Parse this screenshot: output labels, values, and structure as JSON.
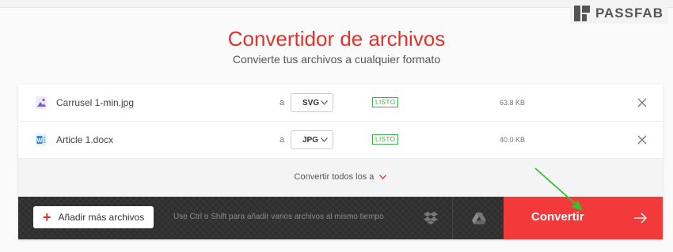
{
  "watermark": {
    "brand": "PASSFAB"
  },
  "header": {
    "title": "Convertidor de archivos",
    "subtitle": "Convierte tus archivos a cualquier formato"
  },
  "files": [
    {
      "name": "Carrusel 1-min.jpg",
      "type_icon": "image-file-icon",
      "to_label": "a",
      "format": "SVG",
      "status": "LISTO",
      "size": "63.8 KB"
    },
    {
      "name": "Article 1.docx",
      "type_icon": "word-file-icon",
      "to_label": "a",
      "format": "JPG",
      "status": "LISTO",
      "size": "40.0 KB"
    }
  ],
  "convert_all": {
    "label": "Convertir todos los a"
  },
  "actions": {
    "add_more": "Añadir más archivos",
    "hint": "Use Ctrl o Shift para añadir varios archivos al mismo tiempo",
    "cloud_icons": [
      "dropbox-icon",
      "google-drive-icon"
    ],
    "convert": "Convertir"
  },
  "colors": {
    "accent": "#e5312c",
    "convert_button": "#f23a3a",
    "status_ready": "#3fae49",
    "annotation_arrow": "#2ec52e"
  }
}
